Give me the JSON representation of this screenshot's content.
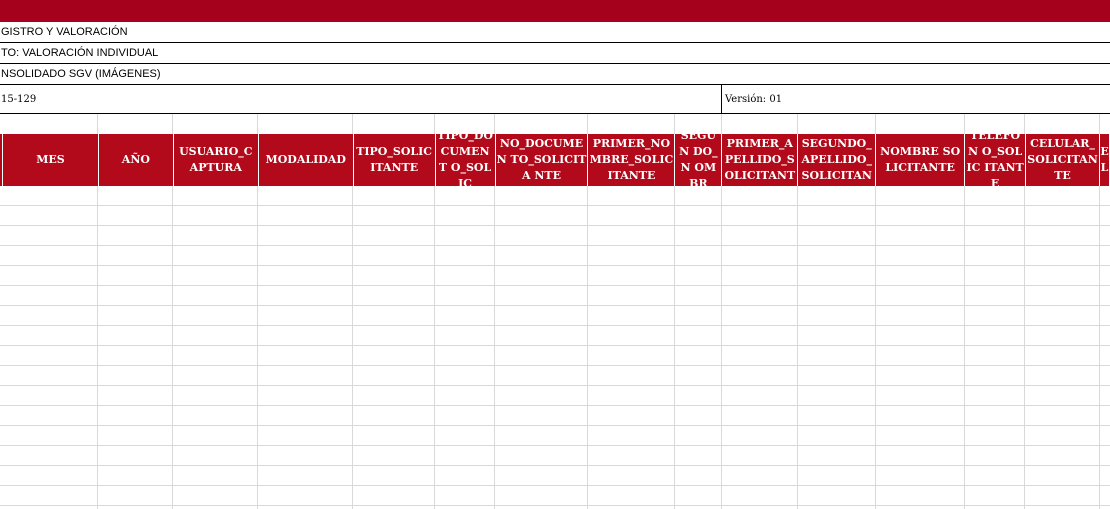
{
  "sheet": {
    "title_row": "GISTRO Y VALORACIÓN",
    "proceso_row": "TO: VALORACIÓN INDIVIDUAL",
    "consolidado_row": "NSOLIDADO SGV (IMÁGENES)",
    "code": "15-129",
    "version": "Versión: 01"
  },
  "columns": [
    {
      "label": ""
    },
    {
      "label": "MES"
    },
    {
      "label": "AÑO"
    },
    {
      "label": "USUARIO_C APTURA"
    },
    {
      "label": "MODALIDAD"
    },
    {
      "label": "TIPO_SOLIC ITANTE"
    },
    {
      "label": "TIPO_DO CUMENT O_SOLIC"
    },
    {
      "label": "NO_DOCUMEN TO_SOLICITA NTE"
    },
    {
      "label": "PRIMER_NO MBRE_SOLIC ITANTE"
    },
    {
      "label": "SEGUN DO_N OMBR"
    },
    {
      "label": "PRIMER_A PELLIDO_S OLICITANT"
    },
    {
      "label": "SEGUNDO_ APELLIDO_ SOLICITAN"
    },
    {
      "label": "NOMBRE SOLICITANTE"
    },
    {
      "label": "TELEFON O_SOLIC ITANTE"
    },
    {
      "label": "CELULAR_ SOLICITAN TE"
    },
    {
      "label": "E L"
    }
  ],
  "colors": {
    "header_red": "#b30a1b",
    "top_bar_red": "#a5001c"
  }
}
